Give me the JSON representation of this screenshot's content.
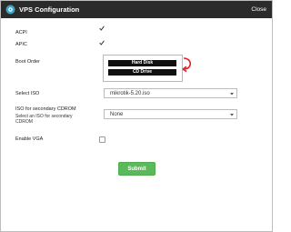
{
  "window": {
    "title": "VPS Configuration",
    "close_label": "Close"
  },
  "form": {
    "acpi": {
      "label": "ACPI",
      "checked": true
    },
    "apic": {
      "label": "APIC",
      "checked": true
    },
    "boot_order": {
      "label": "Boot Order",
      "items": [
        "Hard Disk",
        "CD Drive"
      ]
    },
    "select_iso": {
      "label": "Select ISO",
      "value": "mikrotik-5.20.iso"
    },
    "secondary_cdrom": {
      "label": "ISO for secondary CDROM",
      "help": "Select an ISO for secondary CDROM",
      "value": "None"
    },
    "enable_vga": {
      "label": "Enable VGA",
      "checked": false
    },
    "submit_label": "Submit"
  },
  "colors": {
    "titlebar": "#2b2b2b",
    "submit": "#5cb85c",
    "boot_arrow": "#e0202a"
  },
  "icons": {
    "title": "vps-logo-icon",
    "check": "checkmark-icon",
    "select": "caret-down-icon",
    "boot_arrow": "curved-arrow-icon"
  }
}
